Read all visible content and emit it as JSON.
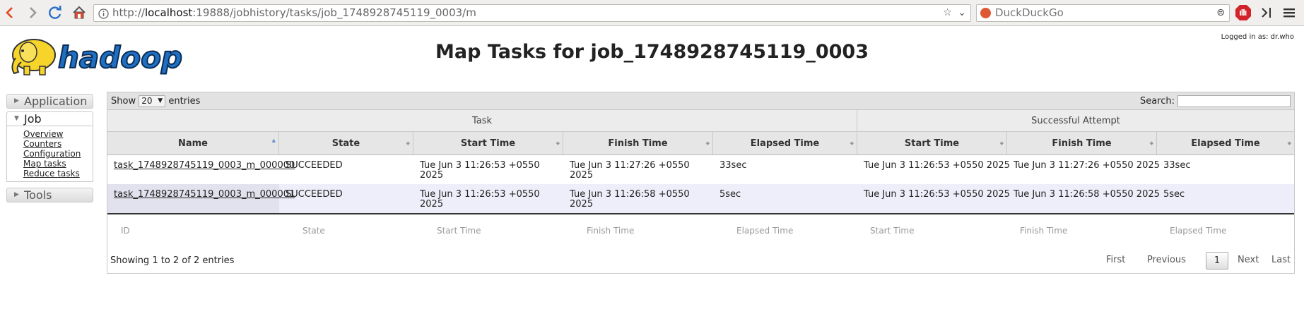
{
  "browser": {
    "url_prefix": "http://",
    "url_host": "localhost",
    "url_rest": ":19888/jobhistory/tasks/job_1748928745119_0003/m",
    "search_placeholder": "DuckDuckGo",
    "icons": [
      "back-icon",
      "forward-icon",
      "reload-icon",
      "home-icon",
      "info-icon",
      "bookmark-star-icon",
      "dropdown-icon",
      "duckduckgo-icon",
      "search-go-icon",
      "adblock-icon",
      "sidebar-icon",
      "menu-icon"
    ]
  },
  "header": {
    "logged_in": "Logged in as: dr.who",
    "title": "Map Tasks for job_1748928745119_0003",
    "logo_text": "hadoop"
  },
  "nav": {
    "application": "Application",
    "job": "Job",
    "job_links": [
      "Overview",
      "Counters",
      "Configuration",
      "Map tasks",
      "Reduce tasks"
    ],
    "tools": "Tools"
  },
  "table": {
    "show_label": "Show",
    "page_size": "20",
    "entries_label": "entries",
    "search_label": "Search:",
    "group_task": "Task",
    "group_attempt": "Successful Attempt",
    "columns": [
      "Name",
      "State",
      "Start Time",
      "Finish Time",
      "Elapsed Time",
      "Start Time",
      "Finish Time",
      "Elapsed Time"
    ],
    "rows": [
      {
        "name": "task_1748928745119_0003_m_000000",
        "state": "SUCCEEDED",
        "start_l1": "Tue Jun 3 11:26:53 +0550",
        "start_l2": "2025",
        "finish_l1": "Tue Jun 3 11:27:26 +0550",
        "finish_l2": "2025",
        "elapsed": "33sec",
        "a_start": "Tue Jun 3 11:26:53 +0550 2025",
        "a_finish": "Tue Jun 3 11:27:26 +0550 2025",
        "a_elapsed": "33sec"
      },
      {
        "name": "task_1748928745119_0003_m_000001",
        "state": "SUCCEEDED",
        "start_l1": "Tue Jun 3 11:26:53 +0550",
        "start_l2": "2025",
        "finish_l1": "Tue Jun 3 11:26:58 +0550",
        "finish_l2": "2025",
        "elapsed": "5sec",
        "a_start": "Tue Jun 3 11:26:53 +0550 2025",
        "a_finish": "Tue Jun 3 11:26:58 +0550 2025",
        "a_elapsed": "5sec"
      }
    ],
    "footer": [
      "ID",
      "State",
      "Start Time",
      "Finish Time",
      "Elapsed Time",
      "Start Time",
      "Finish Time",
      "Elapsed Time"
    ],
    "info": "Showing 1 to 2 of 2 entries",
    "pager": {
      "first": "First",
      "previous": "Previous",
      "current": "1",
      "next": "Next",
      "last": "Last"
    }
  }
}
